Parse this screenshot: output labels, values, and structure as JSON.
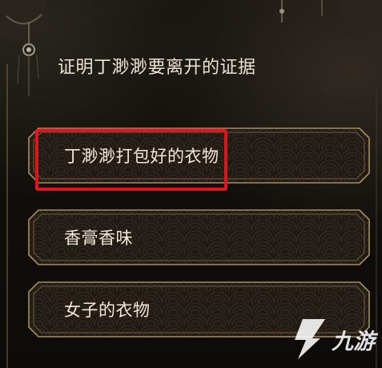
{
  "question": {
    "text": "证明丁渺渺要离开的证据"
  },
  "options": [
    {
      "label": "丁渺渺打包好的衣物",
      "highlighted": true
    },
    {
      "label": "香膏香味",
      "highlighted": false
    },
    {
      "label": "女子的衣物",
      "highlighted": false
    }
  ],
  "highlight_color": "#e1141c",
  "watermark": {
    "text": "九游",
    "icon": "nine-game-logo-icon"
  },
  "colors": {
    "panel": "#1c1813",
    "frame_gold": "#a88d5f",
    "text": "#f1e8d6"
  }
}
